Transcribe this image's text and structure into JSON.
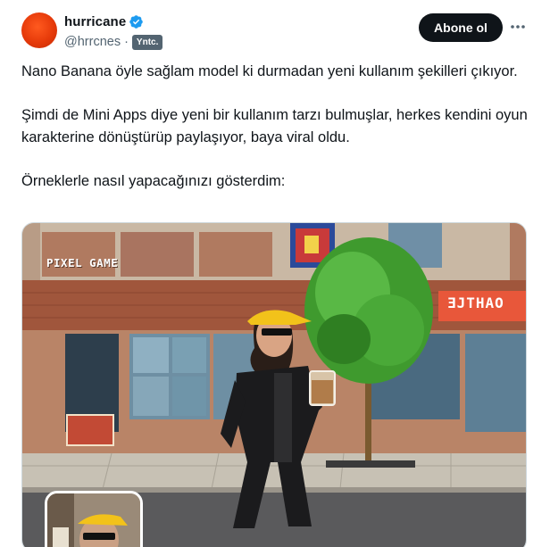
{
  "author": {
    "display_name": "hurricane",
    "handle": "@hrrcnes",
    "separator": "·",
    "translate_badge": "Yntc.",
    "verified": true
  },
  "actions": {
    "follow_label": "Abone ol",
    "more_icon": "more-horizontal-icon"
  },
  "tweet": {
    "paragraph_1": "Nano Banana öyle sağlam model ki durmadan yeni kullanım şekilleri çıkıyor.",
    "paragraph_2": "Şimdi de Mini Apps diye yeni bir kullanım tarzı bulmuşlar, herkes kendini oyun karakterine dönüştürüp paylaşıyor, baya viral oldu.",
    "paragraph_3": "Örneklerle nasıl yapacağınızı gösterdim:"
  },
  "media": {
    "label": "PIXEL GAME",
    "shop_sign": "ƎJTHAO"
  },
  "colors": {
    "accent": "#1d9bf0",
    "text": "#0f1419",
    "muted": "#536471"
  }
}
